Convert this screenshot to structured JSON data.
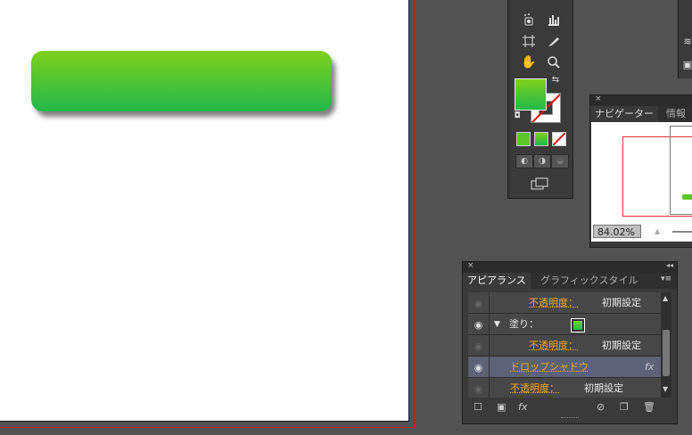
{
  "navigator": {
    "tabs": [
      "ナビゲーター",
      "情報"
    ],
    "zoom": "84.02%",
    "close": "×"
  },
  "appearance": {
    "tabs": [
      "アピアランス",
      "グラフィックスタイル"
    ],
    "close": "×",
    "collapse": "◂◂",
    "menu": "▾≡",
    "rows": [
      {
        "label": "不透明度：",
        "value": "初期設定"
      },
      {
        "label": "塗り："
      },
      {
        "label": "不透明度：",
        "value": "初期設定"
      },
      {
        "label": "ドロップシャドウ",
        "fx": "fx"
      },
      {
        "label": "不透明度：",
        "value": "初期設定"
      }
    ],
    "fx_button": "fx"
  },
  "colors": {
    "fill_top": "#7fd11c",
    "fill_bottom": "#20b84a",
    "selection": "#5c6377",
    "orange_text": "#f5a623",
    "artboard_border": "#c02020"
  }
}
